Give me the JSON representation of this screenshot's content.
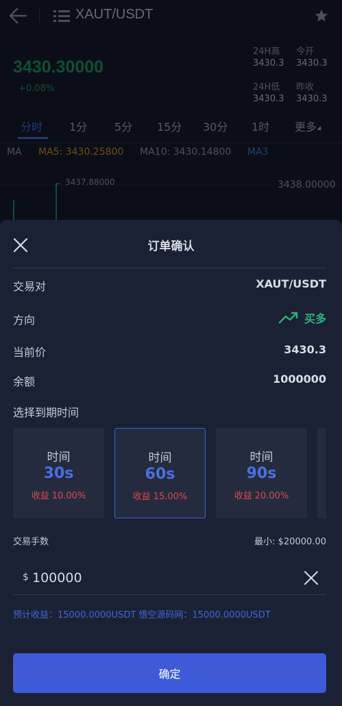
{
  "header": {
    "pair": "XAUT/USDT"
  },
  "ticker": {
    "price": "3430.30000",
    "change": "+0.08%",
    "stats": [
      {
        "label": "24H高",
        "value": "3430.3"
      },
      {
        "label": "今开",
        "value": "3430.3"
      },
      {
        "label": "24H低",
        "value": "3430.3"
      },
      {
        "label": "昨收",
        "value": "3430.3"
      }
    ]
  },
  "intervals": [
    "分时",
    "1分",
    "5分",
    "15分",
    "30分",
    "1时",
    "更多"
  ],
  "ma": {
    "ma": "MA",
    "ma5": "MA5: 3430.25800",
    "ma10": "MA10: 3430.14800",
    "ma30": "MA3"
  },
  "chart": {
    "high_label": "3437.88000",
    "axis_label": "3438.00000"
  },
  "modal": {
    "title": "订单确认",
    "rows": {
      "pair": {
        "label": "交易对",
        "value": "XAUT/USDT"
      },
      "direction": {
        "label": "方向",
        "value": "买多"
      },
      "price": {
        "label": "当前价",
        "value": "3430.3"
      },
      "balance": {
        "label": "余额",
        "value": "1000000"
      }
    },
    "expiry_label": "选择到期时间",
    "durations": [
      {
        "label": "时间",
        "time": "30s",
        "yield_label": "收益",
        "yield": "10.00%"
      },
      {
        "label": "时间",
        "time": "60s",
        "yield_label": "收益",
        "yield": "15.00%"
      },
      {
        "label": "时间",
        "time": "90s",
        "yield_label": "收益",
        "yield": "20.00%"
      }
    ],
    "selected_duration": "60s",
    "lots_label": "交易手数",
    "min_label": "最小: $20000.00",
    "currency_symbol": "$",
    "amount": "100000",
    "estimate": "预计收益：15000.0000USDT  悟空源码网：15000.0000USDT",
    "confirm_label": "确定"
  },
  "colors": {
    "up": "#29b37a",
    "accent": "#3d5bd9",
    "loss": "#e0474c"
  }
}
